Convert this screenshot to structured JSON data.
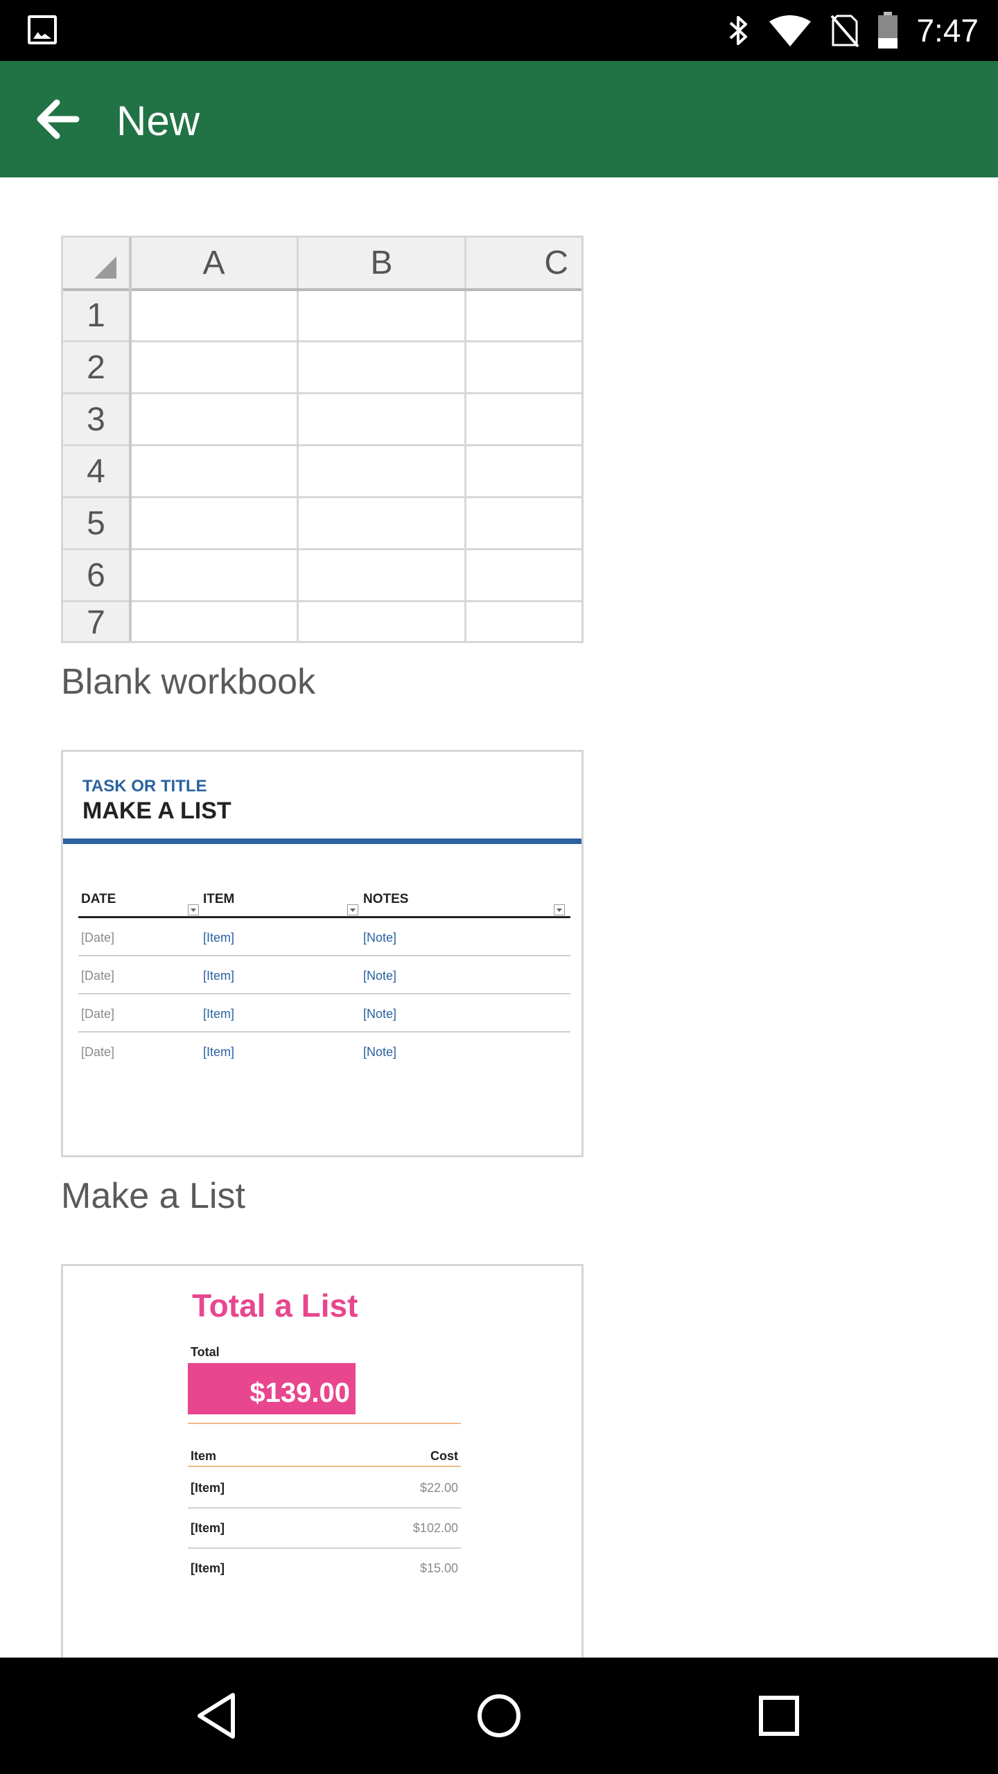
{
  "status_bar": {
    "time": "7:47"
  },
  "app_bar": {
    "title": "New"
  },
  "blank_workbook": {
    "columns": [
      "A",
      "B",
      "C"
    ],
    "rows": [
      "1",
      "2",
      "3",
      "4",
      "5",
      "6",
      "7"
    ],
    "label": "Blank workbook"
  },
  "make_a_list": {
    "label": "Make a List",
    "preview": {
      "task": "TASK OR TITLE",
      "title": "MAKE A LIST",
      "headers": [
        "DATE",
        "ITEM",
        "NOTES"
      ],
      "rows": [
        [
          "[Date]",
          "[Item]",
          "[Note]"
        ],
        [
          "[Date]",
          "[Item]",
          "[Note]"
        ],
        [
          "[Date]",
          "[Item]",
          "[Note]"
        ],
        [
          "[Date]",
          "[Item]",
          "[Note]"
        ]
      ]
    }
  },
  "total_a_list": {
    "preview": {
      "title": "Total a List",
      "total_label": "Total",
      "total_value": "$139.00",
      "headers": [
        "Item",
        "Cost"
      ],
      "rows": [
        [
          "[Item]",
          "$22.00"
        ],
        [
          "[Item]",
          "$102.00"
        ],
        [
          "[Item]",
          "$15.00"
        ]
      ]
    }
  },
  "colors": {
    "app_bar": "#217346",
    "accent_blue": "#2b62a0",
    "accent_pink": "#e8468e"
  },
  "icons": [
    "gallery-icon",
    "bluetooth-icon",
    "wifi-icon",
    "no-sim-icon",
    "battery-icon",
    "back-arrow-icon",
    "nav-back-icon",
    "nav-home-icon",
    "nav-recents-icon"
  ]
}
